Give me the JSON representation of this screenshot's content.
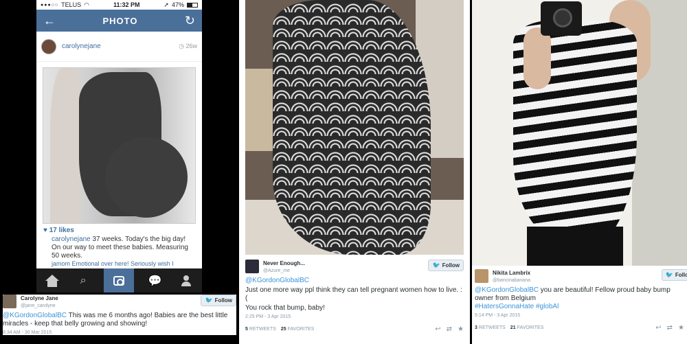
{
  "panel1": {
    "phone": {
      "status": {
        "carrier": "TELUS",
        "time": "11:32 PM",
        "battery": "47%"
      },
      "header": {
        "title": "PHOTO"
      },
      "post": {
        "username": "carolynejane",
        "age": "26w",
        "likes": "17 likes",
        "caption_user": "carolynejane",
        "caption_text": "37 weeks. Today's the big day! On our way to meet these babies. Measuring 50 weeks.",
        "more_comments": "jamom Emotional over here! Seriously wish I"
      },
      "tabbar": [
        "home-icon",
        "search-icon",
        "camera-icon",
        "comment-icon",
        "profile-icon"
      ]
    },
    "tweet": {
      "name": "Carolyne Jane",
      "handle": "@jane_carolyne",
      "follow": "Follow",
      "mention": "@KGordonGlobalBC",
      "text": " This was me 6 months ago! Babies are the best little miracles - keep that belly growing and showing!",
      "time": "8:34 AM - 30 Mar 2015"
    }
  },
  "panel2": {
    "tweet": {
      "name": "Never Enough...",
      "handle": "@Azure_me",
      "follow": "Follow",
      "mention": "@KGordonGlobalBC",
      "text": "Just one more way ppl think they can tell pregnant women how to live. :(",
      "text2": "You rock that bump, baby!",
      "time": "2:25 PM - 3 Apr 2015",
      "retweets": "5",
      "retweets_label": "RETWEETS",
      "favorites": "25",
      "favorites_label": "FAVORITES"
    }
  },
  "panel3": {
    "tweet": {
      "name": "Nikita Lambrix",
      "handle": "@bancinabanana",
      "follow": "Follo",
      "mention": "@KGordonGlobalBC",
      "text": " you are beautiful! Fellow proud baby bump owner from Belgium",
      "hashtags": "#HatersGonnaHate #globAl",
      "time": "5:14 PM - 3 Apr 2015",
      "retweets": "3",
      "retweets_label": "RETWEETS",
      "favorites": "21",
      "favorites_label": "FAVORITES"
    }
  },
  "colors": {
    "instagram_blue": "#4a6f99",
    "twitter_link": "#3b94d9",
    "twitter_bird": "#55acee"
  }
}
